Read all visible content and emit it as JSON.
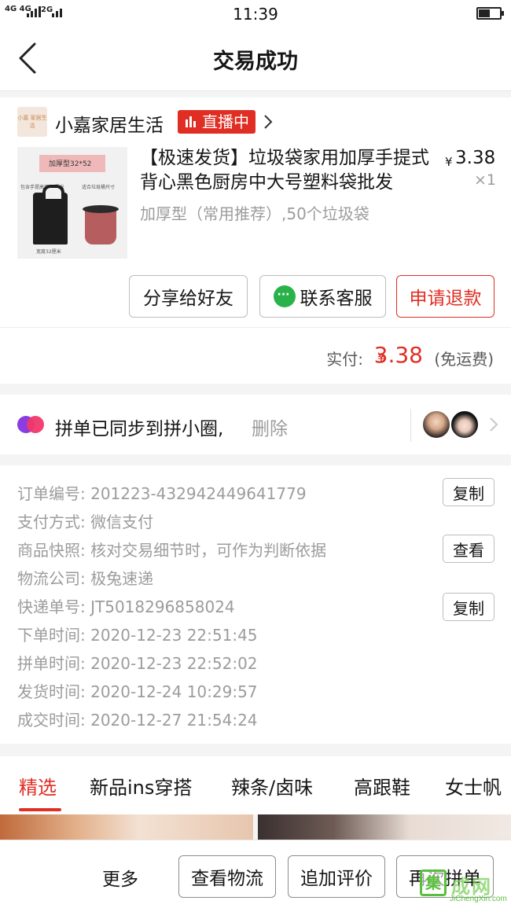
{
  "status_bar": {
    "signal_left": "4G 4G",
    "signal_right": "2G",
    "time": "11:39",
    "battery_level": 0.55
  },
  "header": {
    "title": "交易成功",
    "back_icon": "chevron-left-icon"
  },
  "shop": {
    "logo_text": "小嘉 家居生活",
    "name": "小嘉家居生活",
    "live_label": "直播中"
  },
  "product": {
    "image_label": "加厚型32*52",
    "image_note_left": "包含手提高度52厘米",
    "image_note_right": "适合垃圾桶尺寸",
    "image_note_bottom": "宽度32厘米",
    "title": "【极速发货】垃圾袋家用加厚手提式背心黑色厨房中大号塑料袋批发",
    "spec": "加厚型（常用推荐）,50个垃圾袋",
    "currency": "¥",
    "price": "3.38",
    "quantity": "×1"
  },
  "actions": {
    "share": "分享给好友",
    "contact": "联系客服",
    "refund": "申请退款"
  },
  "payment": {
    "label": "实付:",
    "currency": "¥",
    "amount": "3.38",
    "note": "(免运费)"
  },
  "group_sync": {
    "text": "拼单已同步到拼小圈,",
    "delete": "删除"
  },
  "order_details": {
    "rows": [
      {
        "key": "订单编号:",
        "value": "201223-432942449641779"
      },
      {
        "key": "支付方式:",
        "value": "微信支付"
      },
      {
        "key": "商品快照:",
        "value": "核对交易细节时，可作为判断依据"
      },
      {
        "key": "物流公司:",
        "value": "极兔速递"
      },
      {
        "key": "快递单号:",
        "value": "JT5018296858024"
      },
      {
        "key": "下单时间:",
        "value": "2020-12-23 22:51:45"
      },
      {
        "key": "拼单时间:",
        "value": "2020-12-23 22:52:02"
      },
      {
        "key": "发货时间:",
        "value": "2020-12-24 10:29:57"
      },
      {
        "key": "成交时间:",
        "value": "2020-12-27 21:54:24"
      }
    ],
    "copy_label": "复制",
    "view_label": "查看",
    "copy_label_2": "复制"
  },
  "tabs": [
    "精选",
    "新品ins穿搭",
    "辣条/卤味",
    "高跟鞋",
    "女士帆"
  ],
  "bottom_bar": {
    "more": "更多",
    "logistics": "查看物流",
    "review": "追加评价",
    "regroup": "再次拼单"
  },
  "watermark": {
    "logo": "集",
    "text": "成网",
    "url": "JiChengXin.com"
  },
  "colors": {
    "accent": "#e02e24",
    "text": "#151516",
    "muted": "#9c9c9c"
  }
}
